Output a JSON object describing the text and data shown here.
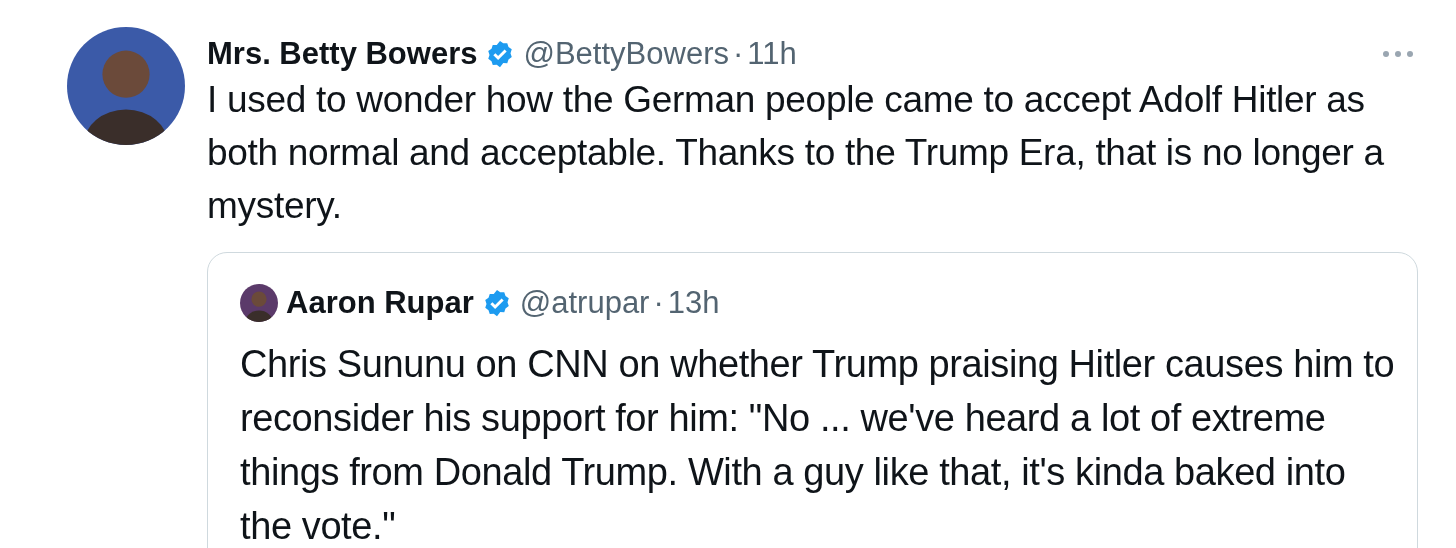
{
  "tweet": {
    "author": "Mrs. Betty Bowers",
    "verified": true,
    "handle": "@BettyBowers",
    "separator": "·",
    "time": "11h",
    "text": "I used to wonder how the German people came to accept Adolf Hitler as both normal and acceptable. Thanks to the Trump Era, that is no longer a mystery.",
    "quoted": {
      "author": "Aaron Rupar",
      "verified": true,
      "handle": "@atrupar",
      "separator": "·",
      "time": "13h",
      "text": "Chris Sununu on CNN on whether Trump praising Hitler causes him to reconsider his support for him: \"No ... we've heard a lot of extreme things from Donald Trump. With a guy like that, it's kinda baked into the vote.\""
    }
  }
}
